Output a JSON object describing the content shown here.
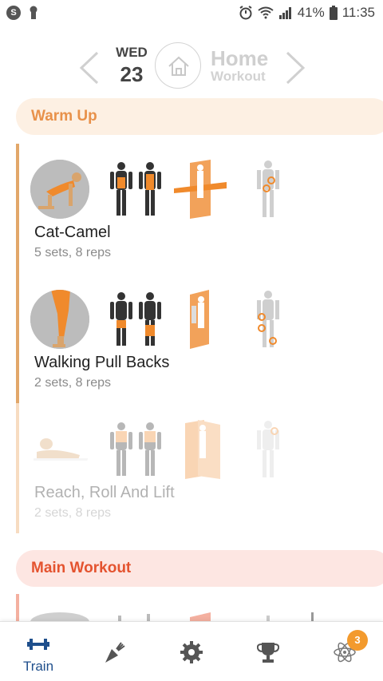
{
  "status_bar": {
    "left_icons": [
      "s-icon",
      "keyhole-icon"
    ],
    "s_letter": "S",
    "right_icons": [
      "alarm-icon",
      "wifi-icon",
      "signal-icon",
      "battery-icon"
    ],
    "battery": "41%",
    "time": "11:35"
  },
  "header": {
    "day_name": "WED",
    "day_number": "23",
    "workout_title": "Home",
    "workout_subtitle": "Workout"
  },
  "sections": {
    "warm_up": "Warm Up",
    "main_workout": "Main Workout"
  },
  "exercises": [
    {
      "name": "Cat-Camel",
      "meta": "5 sets, 8 reps"
    },
    {
      "name": "Walking Pull Backs",
      "meta": "2 sets, 8 reps"
    },
    {
      "name": "Reach, Roll And Lift",
      "meta": "2 sets, 8 reps"
    }
  ],
  "bottom_nav": {
    "train_label": "Train",
    "items": [
      "dumbbell-icon",
      "carrot-icon",
      "gear-icon",
      "trophy-icon",
      "atom-icon"
    ],
    "badge": "3"
  },
  "colors": {
    "accent_orange": "#e8914a",
    "accent_red": "#e4532f",
    "nav_blue": "#1f4f8c",
    "badge": "#f39a2d"
  }
}
